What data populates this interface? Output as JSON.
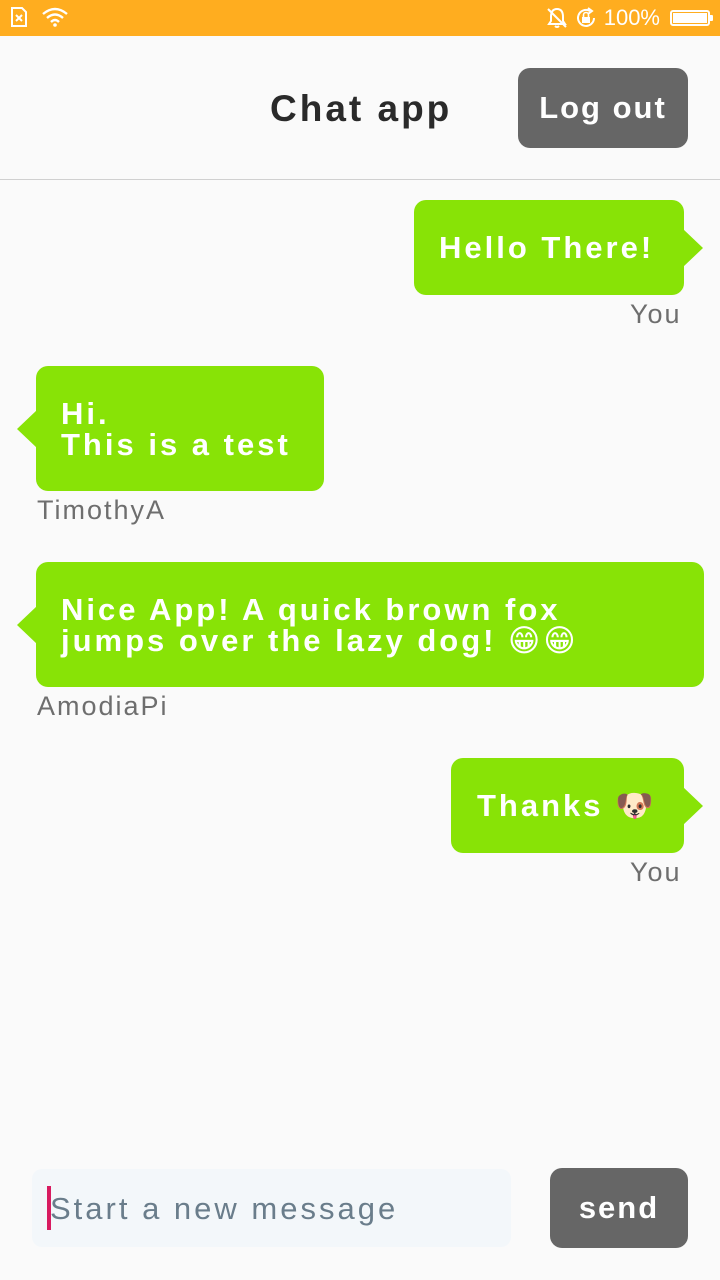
{
  "status_bar": {
    "battery_text": "100%",
    "battery_level": 1.0,
    "icons": [
      "no-sim-icon",
      "wifi-icon",
      "mute-bell-icon",
      "rotation-lock-icon",
      "battery-icon"
    ]
  },
  "header": {
    "title": "Chat app",
    "logout_label": "Log out"
  },
  "messages": [
    {
      "lines": [
        "Hello There!"
      ],
      "sender": "You",
      "direction": "sent"
    },
    {
      "lines": [
        "Hi.",
        "This is a test"
      ],
      "sender": "TimothyA",
      "direction": "received"
    },
    {
      "lines": [
        "Nice App! A quick brown fox",
        "jumps over the lazy dog! 😁😁"
      ],
      "sender": "AmodiaPi",
      "direction": "received"
    },
    {
      "lines": [
        "Thanks 🐶"
      ],
      "sender": "You",
      "direction": "sent"
    }
  ],
  "composer": {
    "placeholder": "Start a new message",
    "send_label": "send"
  },
  "colors": {
    "status_bar": "#ffad1f",
    "bubble": "#88e306",
    "button": "#666666",
    "caret": "#d81b60"
  }
}
